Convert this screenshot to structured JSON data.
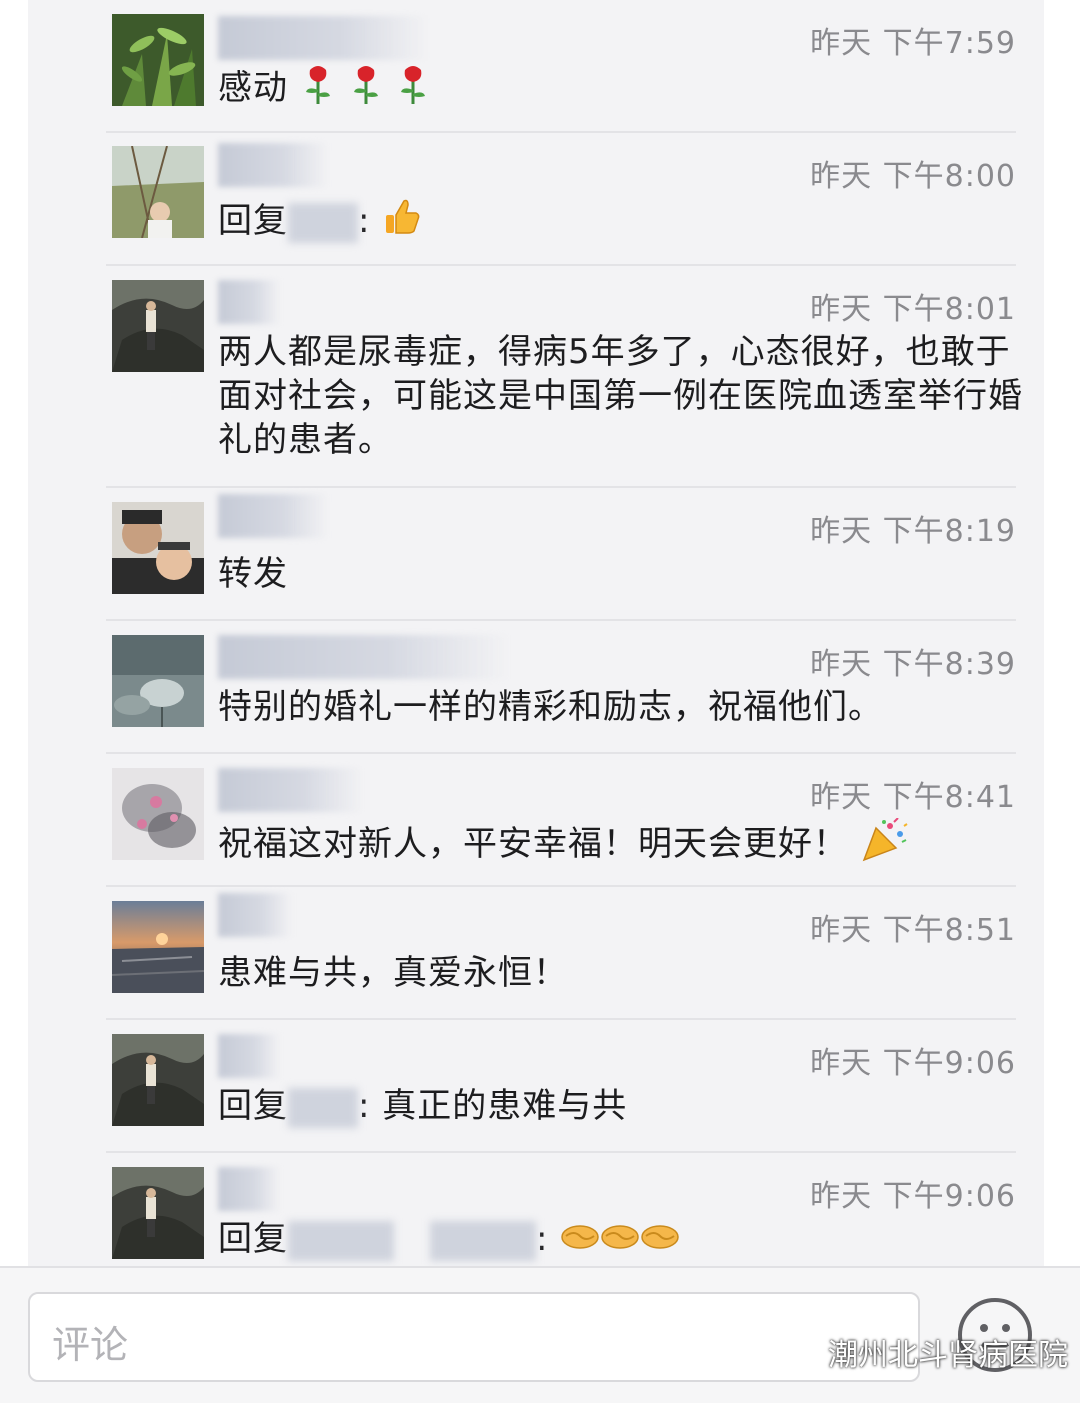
{
  "comments": [
    {
      "time": "昨天 下午7:59",
      "text": "感动"
    },
    {
      "time": "昨天 下午8:00",
      "reply_prefix": "回复",
      "text": ":"
    },
    {
      "time": "昨天 下午8:01",
      "text": "两人都是尿毒症，得病5年多了，心态很好，也敢于面对社会，可能这是中国第一例在医院血透室举行婚礼的患者。"
    },
    {
      "time": "昨天 下午8:19",
      "text": "转发"
    },
    {
      "time": "昨天 下午8:39",
      "text": "特别的婚礼一样的精彩和励志，祝福他们。"
    },
    {
      "time": "昨天 下午8:41",
      "text": "祝福这对新人，平安幸福！明天会更好！"
    },
    {
      "time": "昨天 下午8:51",
      "text": "患难与共，真爱永恒！"
    },
    {
      "time": "昨天 下午9:06",
      "reply_prefix": "回复",
      "text": ": 真正的患难与共"
    },
    {
      "time": "昨天 下午9:06",
      "reply_prefix": "回复",
      "text": ":"
    }
  ],
  "input": {
    "placeholder": "评论"
  },
  "watermark": {
    "text": "潮州北斗肾病医院"
  },
  "icons": {
    "rose": "rose-icon",
    "thumbs_up": "thumbs-up-icon",
    "party_popper": "party-popper-icon",
    "handshake": "handshake-icon",
    "emoji": "smiley-face-icon",
    "wechat": "wechat-icon"
  }
}
